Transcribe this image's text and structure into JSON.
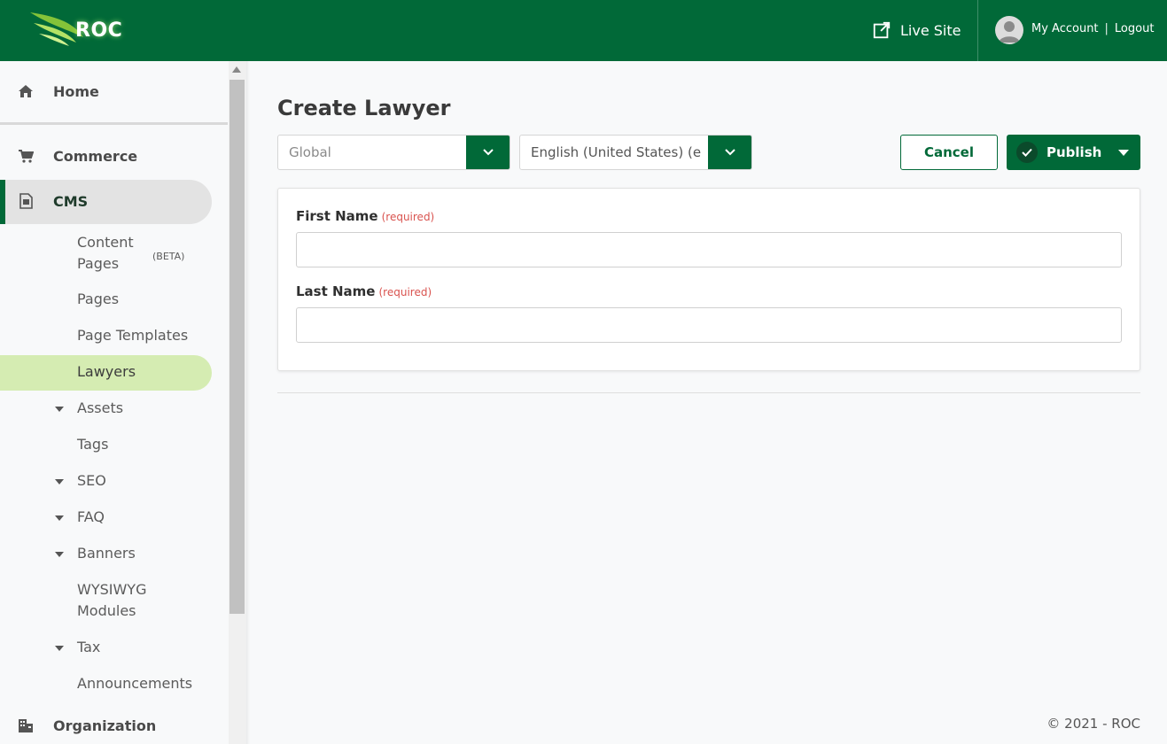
{
  "header": {
    "logo_text": "ROC",
    "live_site": "Live Site",
    "my_account": "My Account",
    "separator": "|",
    "logout": "Logout"
  },
  "sidebar": {
    "home": "Home",
    "commerce": "Commerce",
    "cms": "CMS",
    "content_pages": "Content Pages",
    "beta": "(BETA)",
    "pages": "Pages",
    "page_templates": "Page Templates",
    "lawyers": "Lawyers",
    "assets": "Assets",
    "tags": "Tags",
    "seo": "SEO",
    "faq": "FAQ",
    "banners": "Banners",
    "wysiwyg_modules": "WYSIWYG Modules",
    "tax": "Tax",
    "announcements": "Announcements",
    "organization": "Organization"
  },
  "main": {
    "title": "Create Lawyer",
    "store_select": "Global",
    "language_select": "English (United States) (e",
    "cancel": "Cancel",
    "publish": "Publish",
    "first_name_label": "First Name",
    "last_name_label": "Last Name",
    "required": "(required)",
    "first_name_value": "",
    "last_name_value": ""
  },
  "footer": {
    "copyright": "© 2021 - ROC"
  },
  "colors": {
    "brand": "#016938",
    "active_item": "#d5ecb2",
    "required": "#d9534f"
  }
}
